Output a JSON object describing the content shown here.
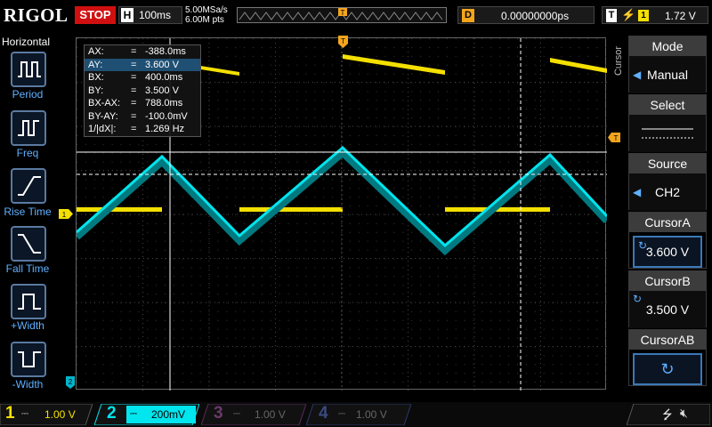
{
  "brand": "RIGOL",
  "run_state": "STOP",
  "horizontal": {
    "label": "H",
    "timebase": "100ms",
    "sample_rate": "5.00MSa/s",
    "points": "6.00M pts"
  },
  "trigger_marker": "T",
  "delay": {
    "label": "D",
    "value": "0.00000000ps"
  },
  "trigger": {
    "label": "T",
    "edge_icon": "rising-edge-icon",
    "source": "1",
    "level": "1.72 V"
  },
  "left_menu": {
    "title": "Horizontal",
    "items": [
      {
        "label": "Period",
        "icon": "period-icon"
      },
      {
        "label": "Freq",
        "icon": "freq-icon"
      },
      {
        "label": "Rise Time",
        "icon": "rise-time-icon"
      },
      {
        "label": "Fall Time",
        "icon": "fall-time-icon"
      },
      {
        "label": "+Width",
        "icon": "plus-width-icon"
      },
      {
        "label": "-Width",
        "icon": "minus-width-icon"
      }
    ]
  },
  "measurements": [
    {
      "key": "AX:",
      "eq": "=",
      "value": "-388.0ms"
    },
    {
      "key": "AY:",
      "eq": "=",
      "value": "3.600 V"
    },
    {
      "key": "BX:",
      "eq": "=",
      "value": "400.0ms"
    },
    {
      "key": "BY:",
      "eq": "=",
      "value": "3.500 V"
    },
    {
      "key": "BX-AX:",
      "eq": "=",
      "value": "788.0ms"
    },
    {
      "key": "BY-AY:",
      "eq": "=",
      "value": "-100.0mV"
    },
    {
      "key": "1/|dX|:",
      "eq": "=",
      "value": "1.269 Hz"
    }
  ],
  "markers": {
    "ch1": "1",
    "ch2": "2",
    "trig_level": "T"
  },
  "right_menu": {
    "side_label": "Cursor",
    "mode": {
      "title": "Mode",
      "value": "Manual"
    },
    "select": {
      "title": "Select"
    },
    "source": {
      "title": "Source",
      "value": "CH2"
    },
    "cursor_a": {
      "title": "CursorA",
      "value": "3.600 V"
    },
    "cursor_b": {
      "title": "CursorB",
      "value": "3.500 V"
    },
    "cursor_ab": {
      "title": "CursorAB"
    }
  },
  "channels": [
    {
      "num": "1",
      "scale": "1.00 V",
      "color": "#f4e000"
    },
    {
      "num": "2",
      "scale": "200mV",
      "color": "#00e5ee"
    },
    {
      "num": "3",
      "scale": "1.00 V",
      "color": "#c850c8"
    },
    {
      "num": "4",
      "scale": "1.00 V",
      "color": "#3a78e8"
    }
  ],
  "colors": {
    "ch1": "#f4e000",
    "ch2": "#00e5ee",
    "trigger": "#f4a51c",
    "stop": "#d01010"
  }
}
